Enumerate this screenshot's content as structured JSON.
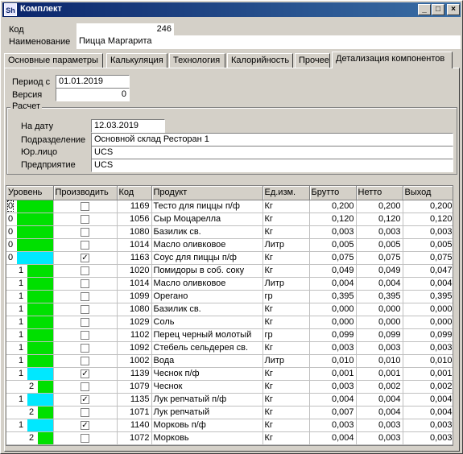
{
  "window": {
    "title": "Комплект",
    "icon_text": "Sh"
  },
  "header": {
    "code_label": "Код",
    "code_value": "246",
    "name_label": "Наименование",
    "name_value": "Пицца Маргарита"
  },
  "tabs": [
    {
      "label": "Основные параметры",
      "active": false
    },
    {
      "label": "Калькуляция",
      "active": false
    },
    {
      "label": "Технология",
      "active": false
    },
    {
      "label": "Калорийность",
      "active": false
    },
    {
      "label": "Прочее",
      "active": false
    },
    {
      "label": "Детализация компонентов",
      "active": true
    }
  ],
  "period": {
    "label": "Период с",
    "value": "01.01.2019",
    "version_label": "Версия",
    "version_value": "0"
  },
  "calc": {
    "title": "Расчет",
    "date_label": "На дату",
    "date_value": "12.03.2019",
    "division_label": "Подразделение",
    "division_value": "Основной склад Ресторан 1",
    "legal_label": "Юр.лицо",
    "legal_value": "UCS",
    "enterprise_label": "Предприятие",
    "enterprise_value": "UCS"
  },
  "grid": {
    "columns": [
      "Уровень",
      "Производить",
      "Код",
      "Продукт",
      "Ед.изм.",
      "Брутто",
      "Нетто",
      "Выход"
    ],
    "rows": [
      {
        "level": "0",
        "color": "#00e000",
        "produce": false,
        "code": "1169",
        "product": "Тесто для пиццы п/ф",
        "unit": "Кг",
        "gross": "0,200",
        "net": "0,200",
        "yield": "0,200"
      },
      {
        "level": "0",
        "color": "#00e000",
        "produce": false,
        "code": "1056",
        "product": "Сыр Моцарелла",
        "unit": "Кг",
        "gross": "0,120",
        "net": "0,120",
        "yield": "0,120"
      },
      {
        "level": "0",
        "color": "#00e000",
        "produce": false,
        "code": "1080",
        "product": "Базилик св.",
        "unit": "Кг",
        "gross": "0,003",
        "net": "0,003",
        "yield": "0,003"
      },
      {
        "level": "0",
        "color": "#00e000",
        "produce": false,
        "code": "1014",
        "product": "Масло оливковое",
        "unit": "Литр",
        "gross": "0,005",
        "net": "0,005",
        "yield": "0,005"
      },
      {
        "level": "0",
        "color": "#00e8ff",
        "produce": true,
        "code": "1163",
        "product": "Соус для пиццы п/ф",
        "unit": "Кг",
        "gross": "0,075",
        "net": "0,075",
        "yield": "0,075"
      },
      {
        "level": "1",
        "color": "#00e000",
        "produce": false,
        "code": "1020",
        "product": "Помидоры в соб. соку",
        "unit": "Кг",
        "gross": "0,049",
        "net": "0,049",
        "yield": "0,047"
      },
      {
        "level": "1",
        "color": "#00e000",
        "produce": false,
        "code": "1014",
        "product": "Масло оливковое",
        "unit": "Литр",
        "gross": "0,004",
        "net": "0,004",
        "yield": "0,004"
      },
      {
        "level": "1",
        "color": "#00e000",
        "produce": false,
        "code": "1099",
        "product": "Орегано",
        "unit": "гр",
        "gross": "0,395",
        "net": "0,395",
        "yield": "0,395"
      },
      {
        "level": "1",
        "color": "#00e000",
        "produce": false,
        "code": "1080",
        "product": "Базилик св.",
        "unit": "Кг",
        "gross": "0,000",
        "net": "0,000",
        "yield": "0,000"
      },
      {
        "level": "1",
        "color": "#00e000",
        "produce": false,
        "code": "1029",
        "product": "Соль",
        "unit": "Кг",
        "gross": "0,000",
        "net": "0,000",
        "yield": "0,000"
      },
      {
        "level": "1",
        "color": "#00e000",
        "produce": false,
        "code": "1102",
        "product": "Перец черный молотый",
        "unit": "гр",
        "gross": "0,099",
        "net": "0,099",
        "yield": "0,099"
      },
      {
        "level": "1",
        "color": "#00e000",
        "produce": false,
        "code": "1092",
        "product": "Стебель сельдерея св.",
        "unit": "Кг",
        "gross": "0,003",
        "net": "0,003",
        "yield": "0,003"
      },
      {
        "level": "1",
        "color": "#00e000",
        "produce": false,
        "code": "1002",
        "product": "Вода",
        "unit": "Литр",
        "gross": "0,010",
        "net": "0,010",
        "yield": "0,010"
      },
      {
        "level": "1",
        "color": "#00e8ff",
        "produce": true,
        "code": "1139",
        "product": "Чеснок п/ф",
        "unit": "Кг",
        "gross": "0,001",
        "net": "0,001",
        "yield": "0,001"
      },
      {
        "level": "2",
        "color": "#00e000",
        "produce": false,
        "code": "1079",
        "product": "Чеснок",
        "unit": "Кг",
        "gross": "0,003",
        "net": "0,002",
        "yield": "0,002"
      },
      {
        "level": "1",
        "color": "#00e8ff",
        "produce": true,
        "code": "1135",
        "product": "Лук репчатый п/ф",
        "unit": "Кг",
        "gross": "0,004",
        "net": "0,004",
        "yield": "0,004"
      },
      {
        "level": "2",
        "color": "#00e000",
        "produce": false,
        "code": "1071",
        "product": "Лук репчатый",
        "unit": "Кг",
        "gross": "0,007",
        "net": "0,004",
        "yield": "0,004"
      },
      {
        "level": "1",
        "color": "#00e8ff",
        "produce": true,
        "code": "1140",
        "product": "Морковь п/ф",
        "unit": "Кг",
        "gross": "0,003",
        "net": "0,003",
        "yield": "0,003"
      },
      {
        "level": "2",
        "color": "#00e000",
        "produce": false,
        "code": "1072",
        "product": "Морковь",
        "unit": "Кг",
        "gross": "0,004",
        "net": "0,003",
        "yield": "0,003"
      }
    ]
  }
}
